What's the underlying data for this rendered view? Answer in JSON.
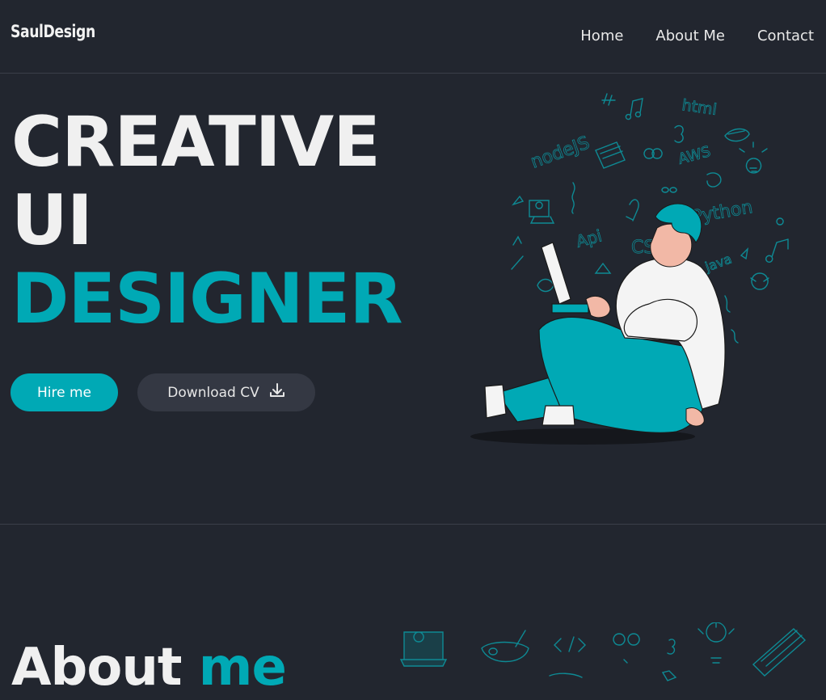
{
  "header": {
    "brand": "SaulDesign",
    "nav": [
      {
        "label": "Home"
      },
      {
        "label": "About Me"
      },
      {
        "label": "Contact"
      }
    ]
  },
  "hero": {
    "line1": "CREATIVE",
    "line2": "UI",
    "line3": "DESIGNER",
    "hire_label": "Hire me",
    "cv_label": "Download CV",
    "illustration_words": [
      "html",
      "nodeJS",
      "AWS",
      "Python",
      "Api",
      "CSS",
      "java"
    ]
  },
  "about": {
    "title_a": "About",
    "title_b": "me"
  },
  "colors": {
    "background": "#22262f",
    "accent": "#00a9b5",
    "secondary_button": "#343843",
    "text": "#f0f0f0"
  }
}
